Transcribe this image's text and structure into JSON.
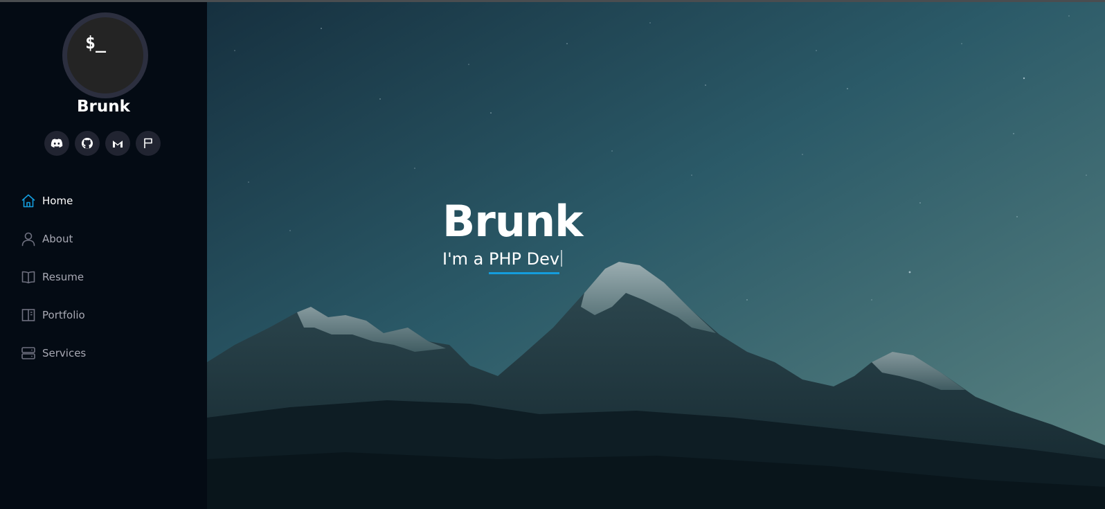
{
  "profile": {
    "avatar_text": "$_",
    "name": "Brunk"
  },
  "social_links": [
    {
      "icon": "discord-icon"
    },
    {
      "icon": "github-icon"
    },
    {
      "icon": "gmail-icon"
    },
    {
      "icon": "flag-icon"
    }
  ],
  "nav": {
    "items": [
      {
        "label": "Home",
        "icon": "home-icon",
        "active": true
      },
      {
        "label": "About",
        "icon": "user-icon",
        "active": false
      },
      {
        "label": "Resume",
        "icon": "book-icon",
        "active": false
      },
      {
        "label": "Portfolio",
        "icon": "portfolio-icon",
        "active": false
      },
      {
        "label": "Services",
        "icon": "server-icon",
        "active": false
      }
    ]
  },
  "hero": {
    "name": "Brunk",
    "prefix": "I'm a ",
    "typed": "PHP Dev"
  },
  "colors": {
    "accent": "#149ddd",
    "sidebar_bg": "#040b14",
    "nav_text": "#a8a9b4",
    "social_bg": "#212431"
  }
}
